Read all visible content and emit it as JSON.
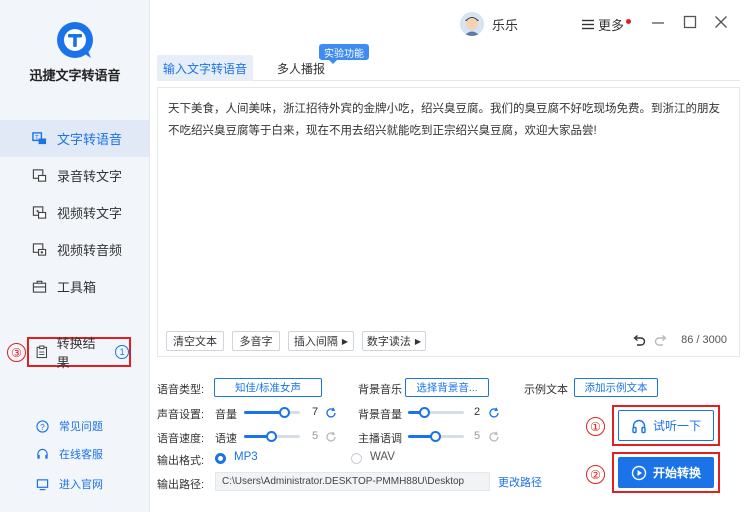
{
  "app": {
    "title": "迅捷文字转语音"
  },
  "sidebar": {
    "items": [
      {
        "label": "文字转语音",
        "icon": "text-to-speech-icon",
        "active": true
      },
      {
        "label": "录音转文字",
        "icon": "record-to-text-icon"
      },
      {
        "label": "视频转文字",
        "icon": "video-to-text-icon"
      },
      {
        "label": "视频转音频",
        "icon": "video-to-audio-icon"
      },
      {
        "label": "工具箱",
        "icon": "toolbox-icon"
      }
    ],
    "result": {
      "label": "转换结果",
      "count": "1"
    },
    "links": [
      {
        "label": "常见问题",
        "icon": "question-icon"
      },
      {
        "label": "在线客服",
        "icon": "headset-icon"
      },
      {
        "label": "进入官网",
        "icon": "monitor-icon"
      }
    ]
  },
  "annotations": {
    "one": "①",
    "two": "②",
    "three": "③"
  },
  "header": {
    "username": "乐乐",
    "more_label": "更多",
    "menu_icon": "menu-icon"
  },
  "tabs": [
    {
      "label": "输入文字转语音"
    },
    {
      "label": "多人播报"
    }
  ],
  "experiment_badge": "实验功能",
  "editor": {
    "text": "天下美食，人间美味，浙江招待外宾的金牌小吃，绍兴臭豆腐。我们的臭豆腐不好吃现场免费。到浙江的朋友不吃绍兴臭豆腐等于白来，现在不用去绍兴就能吃到正宗绍兴臭豆腐，欢迎大家品尝!",
    "toolbar": {
      "clear": "清空文本",
      "polyphone": "多音字",
      "pause": "插入间隔",
      "number": "数字读法"
    },
    "count": "86 / 3000"
  },
  "settings": {
    "voice_type_label": "语音类型:",
    "voice_type_value": "知佳/标准女声",
    "bgm_label": "背景音乐",
    "bgm_button": "选择背景音...",
    "sample_label": "示例文本",
    "sample_button": "添加示例文本",
    "sound_label": "声音设置:",
    "volume_label": "音量",
    "volume_value": "7",
    "bgvol_label": "背景音量",
    "bgvol_value": "2",
    "speed_section_label": "语音速度:",
    "speed_label": "语速",
    "speed_value": "5",
    "pitch_label": "主播语调",
    "pitch_value": "5",
    "format_label": "输出格式:",
    "format_mp3": "MP3",
    "format_wav": "WAV",
    "path_label": "输出路径:",
    "path_value": "C:\\Users\\Administrator.DESKTOP-PMMH88U\\Desktop",
    "change_path": "更改路径"
  },
  "actions": {
    "try": "试听一下",
    "start": "开始转换"
  },
  "colors": {
    "accent": "#1a73e8",
    "highlight": "#e02020",
    "sidebar_bg": "#f2f5fa"
  }
}
